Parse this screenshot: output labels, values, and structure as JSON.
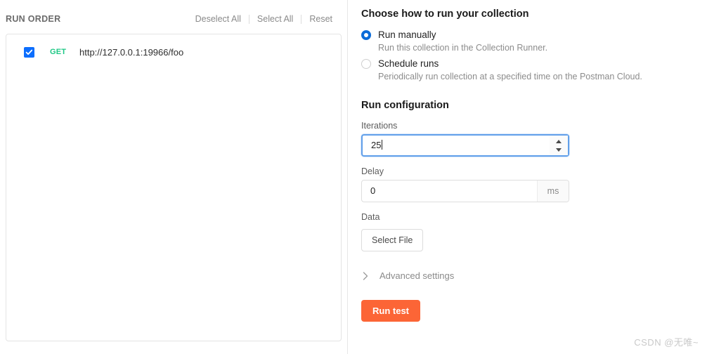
{
  "left_panel": {
    "title": "RUN ORDER",
    "actions": [
      {
        "label": "Deselect All"
      },
      {
        "label": "Select All"
      },
      {
        "label": "Reset"
      }
    ],
    "requests": [
      {
        "checked": true,
        "method": "GET",
        "url": "http://127.0.0.1:19966/foo"
      }
    ]
  },
  "right_panel": {
    "choose_title": "Choose how to run your collection",
    "run_modes": [
      {
        "label": "Run manually",
        "description": "Run this collection in the Collection Runner.",
        "selected": true
      },
      {
        "label": "Schedule runs",
        "description": "Periodically run collection at a specified time on the Postman Cloud.",
        "selected": false
      }
    ],
    "run_config_title": "Run configuration",
    "iterations": {
      "label": "Iterations",
      "value": "25",
      "focused": true
    },
    "delay": {
      "label": "Delay",
      "value": "0",
      "suffix": "ms"
    },
    "data": {
      "label": "Data",
      "button_label": "Select File"
    },
    "advanced_settings_label": "Advanced settings",
    "run_test_label": "Run test"
  },
  "watermark": "CSDN @无唯~",
  "colors": {
    "accent_orange": "#FC6536",
    "checkbox_blue": "#0D6EFD",
    "radio_blue": "#0B6BD8",
    "method_get_green": "#1EC885",
    "focus_border": "#62A0EA"
  }
}
